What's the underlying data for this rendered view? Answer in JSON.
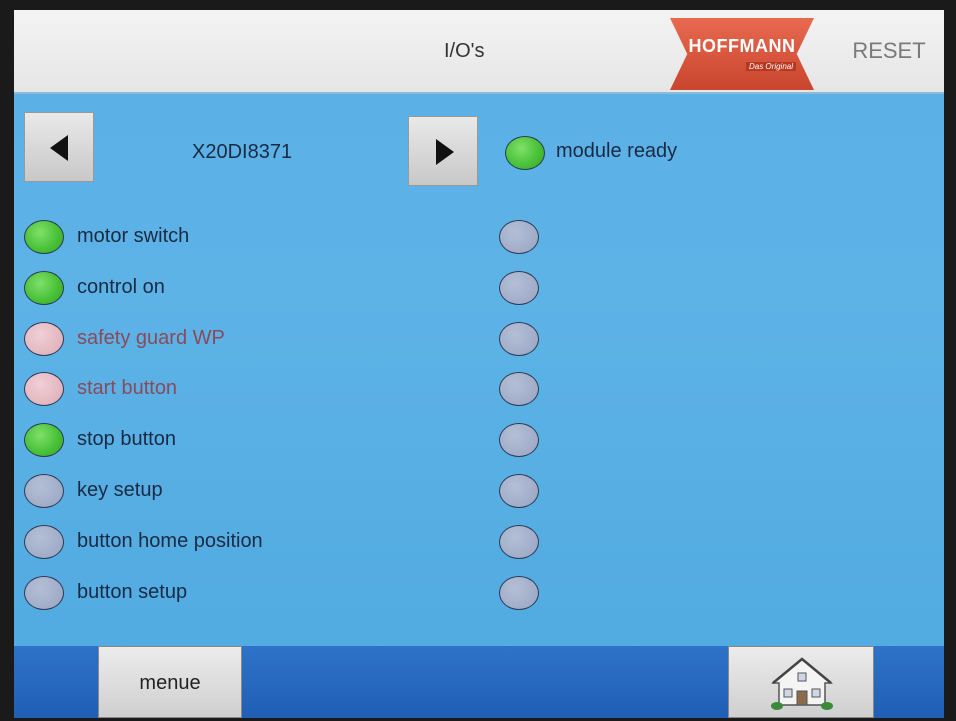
{
  "header": {
    "title": "I/O's",
    "logo_text": "HOFFMANN",
    "logo_tagline": "Das Original",
    "reset_label": "RESET"
  },
  "module": {
    "prev_icon": "arrow-left-icon",
    "next_icon": "arrow-right-icon",
    "name": "X20DI8371",
    "ready_label": "module ready",
    "ready_status": "green"
  },
  "inputs_left": [
    {
      "label": "motor switch",
      "status": "green"
    },
    {
      "label": "control on",
      "status": "green"
    },
    {
      "label": "safety guard WP",
      "status": "pink"
    },
    {
      "label": "start button",
      "status": "pink"
    },
    {
      "label": "stop button",
      "status": "green"
    },
    {
      "label": "key setup",
      "status": "gray"
    },
    {
      "label": "button home position",
      "status": "gray"
    },
    {
      "label": "button setup",
      "status": "gray"
    }
  ],
  "inputs_right": [
    {
      "label": "",
      "status": "gray"
    },
    {
      "label": "",
      "status": "gray"
    },
    {
      "label": "",
      "status": "gray"
    },
    {
      "label": "",
      "status": "gray"
    },
    {
      "label": "",
      "status": "gray"
    },
    {
      "label": "",
      "status": "gray"
    },
    {
      "label": "",
      "status": "gray"
    },
    {
      "label": "",
      "status": "gray"
    }
  ],
  "footer": {
    "menu_label": "menue",
    "home_icon": "home-icon"
  },
  "colors": {
    "led_on": "#46bf35",
    "led_fault": "#dcaab5",
    "led_off": "#98a3c2",
    "background": "#5ab0e6",
    "footer": "#2e73c9",
    "logo": "#c9452e"
  }
}
